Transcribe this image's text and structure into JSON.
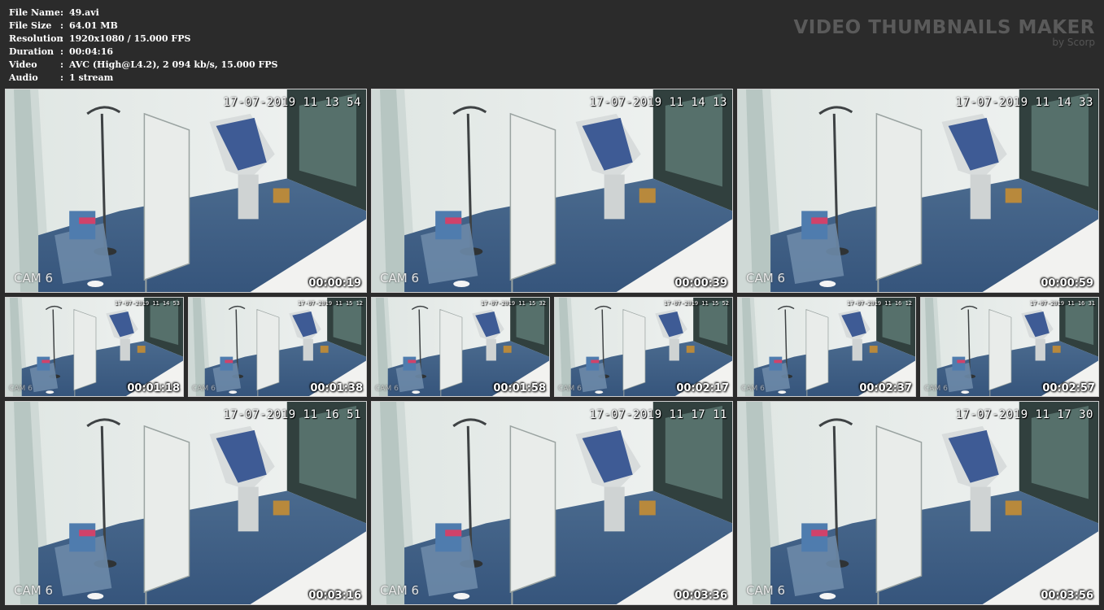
{
  "info": {
    "rows": [
      {
        "key": "File Name",
        "value": "49.avi"
      },
      {
        "key": "File Size",
        "value": "64.01 MB"
      },
      {
        "key": "Resolution",
        "value": "1920x1080 / 15.000 FPS"
      },
      {
        "key": "Duration",
        "value": "00:04:16"
      },
      {
        "key": "Video",
        "value": "AVC (High@L4.2), 2 094 kb/s, 15.000 FPS"
      },
      {
        "key": "Audio",
        "value": "1 stream"
      }
    ],
    "separator": ":"
  },
  "brand": {
    "title": "VIDEO THUMBNAILS MAKER",
    "subtitle": "by Scorp"
  },
  "thumbnails": [
    {
      "stamp": "17-07-2019 11 13 54",
      "cam": "CAM 6",
      "timecode": "00:00:19"
    },
    {
      "stamp": "17-07-2019 11 14 13",
      "cam": "CAM 6",
      "timecode": "00:00:39"
    },
    {
      "stamp": "17-07-2019 11 14 33",
      "cam": "CAM 6",
      "timecode": "00:00:59"
    },
    {
      "stamp": "17-07-2019 11 14 53",
      "cam": "CAM 6",
      "timecode": "00:01:18"
    },
    {
      "stamp": "17-07-2019 11 15 12",
      "cam": "CAM 6",
      "timecode": "00:01:38"
    },
    {
      "stamp": "17-07-2019 11 15 32",
      "cam": "CAM 6",
      "timecode": "00:01:58"
    },
    {
      "stamp": "17-07-2019 11 15 52",
      "cam": "CAM 6",
      "timecode": "00:02:17"
    },
    {
      "stamp": "17-07-2019 11 16 12",
      "cam": "CAM 6",
      "timecode": "00:02:37"
    },
    {
      "stamp": "17-07-2019 11 16 31",
      "cam": "CAM 6",
      "timecode": "00:02:57"
    },
    {
      "stamp": "17-07-2019 11 16 51",
      "cam": "CAM 6",
      "timecode": "00:03:16"
    },
    {
      "stamp": "17-07-2019 11 17 11",
      "cam": "CAM 6",
      "timecode": "00:03:36"
    },
    {
      "stamp": "17-07-2019 11 17 30",
      "cam": "CAM 6",
      "timecode": "00:03:56"
    }
  ],
  "colors": {
    "background": "#2b2b2b",
    "floor": "#3f5f86",
    "wall": "#e6ebe9",
    "border": "#cfcfcf"
  }
}
